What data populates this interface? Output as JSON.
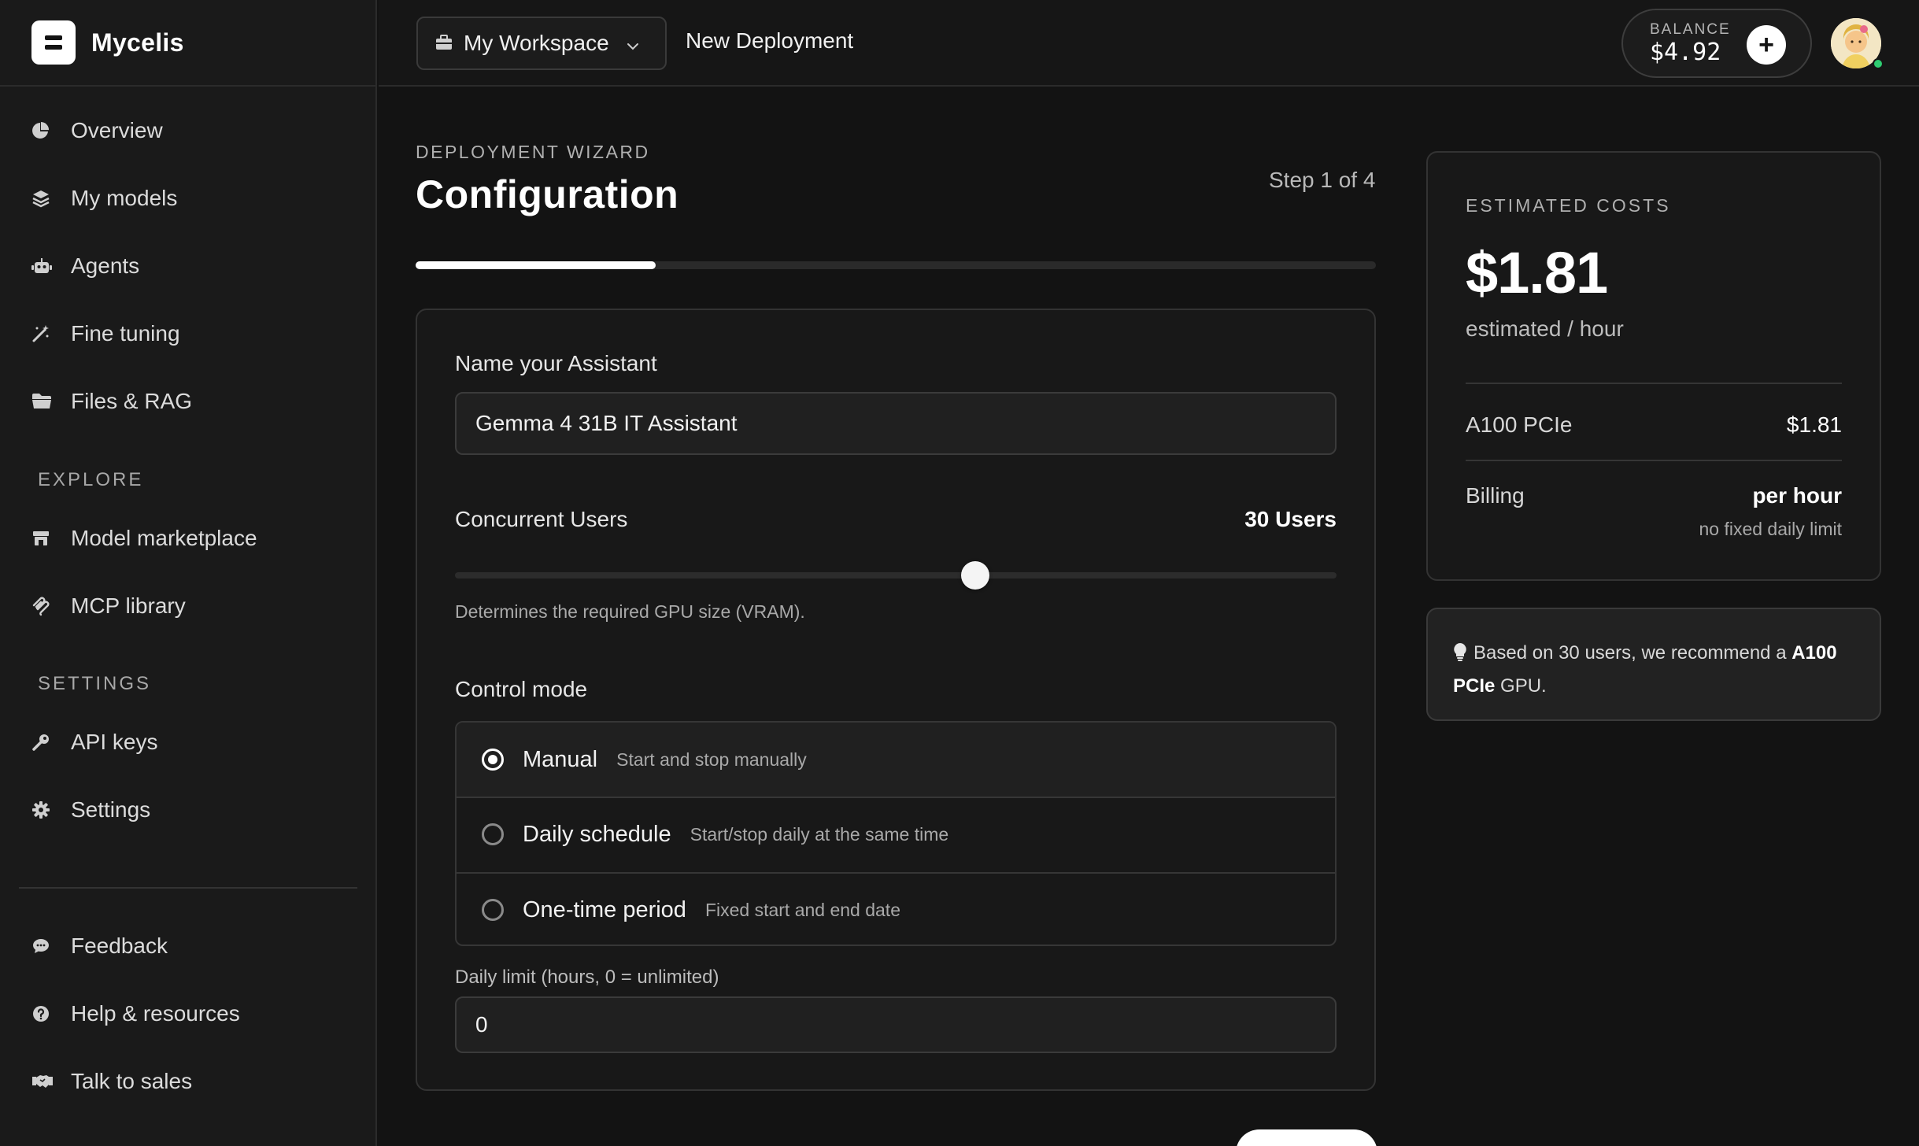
{
  "app": {
    "name": "Mycelis"
  },
  "sidebar": {
    "main_items": [
      {
        "label": "Overview",
        "icon": "pie-chart-icon"
      },
      {
        "label": "My models",
        "icon": "layers-icon"
      },
      {
        "label": "Agents",
        "icon": "robot-icon"
      },
      {
        "label": "Fine tuning",
        "icon": "magic-wand-icon"
      },
      {
        "label": "Files & RAG",
        "icon": "folder-icon"
      }
    ],
    "explore_heading": "EXPLORE",
    "explore_items": [
      {
        "label": "Model marketplace",
        "icon": "store-icon"
      },
      {
        "label": "MCP library",
        "icon": "mcp-icon"
      }
    ],
    "settings_heading": "SETTINGS",
    "settings_items": [
      {
        "label": "API keys",
        "icon": "key-icon"
      },
      {
        "label": "Settings",
        "icon": "gear-icon"
      }
    ],
    "footer_items": [
      {
        "label": "Feedback",
        "icon": "chat-bubble-icon"
      },
      {
        "label": "Help & resources",
        "icon": "help-circle-icon"
      },
      {
        "label": "Talk to sales",
        "icon": "handshake-icon"
      }
    ]
  },
  "header": {
    "workspace": "My Workspace",
    "breadcrumb": "New Deployment",
    "balance_caption": "BALANCE",
    "balance_value": "$4.92"
  },
  "wizard": {
    "eyebrow": "DEPLOYMENT WIZARD",
    "title": "Configuration",
    "step": "Step 1 of 4",
    "progress": 0.25
  },
  "form": {
    "name_label": "Name your Assistant",
    "name_value": "Gemma 4 31B IT Assistant",
    "users_label": "Concurrent Users",
    "users_value": "30 Users",
    "users_slider_fraction": 0.59,
    "users_help": "Determines the required GPU size (VRAM).",
    "control_label": "Control mode",
    "control_options": [
      {
        "title": "Manual",
        "desc": "Start and stop manually",
        "selected": true
      },
      {
        "title": "Daily schedule",
        "desc": "Start/stop daily at the same time",
        "selected": false
      },
      {
        "title": "One-time period",
        "desc": "Fixed start and end date",
        "selected": false
      }
    ],
    "limit_label": "Daily limit (hours, 0 = unlimited)",
    "limit_value": "0"
  },
  "costs": {
    "caption": "ESTIMATED COSTS",
    "amount": "$1.81",
    "per": "estimated / hour",
    "gpu_label": "A100 PCIe",
    "gpu_price": "$1.81",
    "billing_label": "Billing",
    "billing_value": "per hour",
    "billing_note": "no fixed daily limit"
  },
  "recommendation": {
    "prefix": "Based on 30 users, we recommend a ",
    "gpu": "A100 PCIe",
    "suffix": " GPU."
  },
  "colors": {
    "background": "#131313",
    "panel": "#181818",
    "accent": "#ffffff",
    "online": "#2ecc71"
  }
}
